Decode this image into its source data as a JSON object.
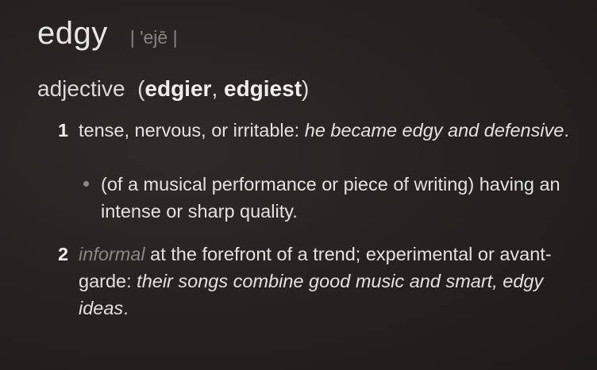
{
  "entry": {
    "headword": "edgy",
    "pronunciation": "| 'ejē |",
    "part_of_speech": "adjective",
    "forms_open": "(",
    "comparative": "edgier",
    "forms_sep": ", ",
    "superlative": "edgiest",
    "forms_close": ")"
  },
  "senses": [
    {
      "number": "1",
      "definition": "tense, nervous, or irritable: ",
      "example": "he became edgy and defensive",
      "end": ".",
      "subsense": "(of a musical performance or piece of writing) having an intense or sharp quality."
    },
    {
      "number": "2",
      "register": "informal",
      "definition": " at the forefront of a trend; experimental or avant-garde: ",
      "example": "their songs combine good music and smart, edgy ideas",
      "end": "."
    }
  ]
}
